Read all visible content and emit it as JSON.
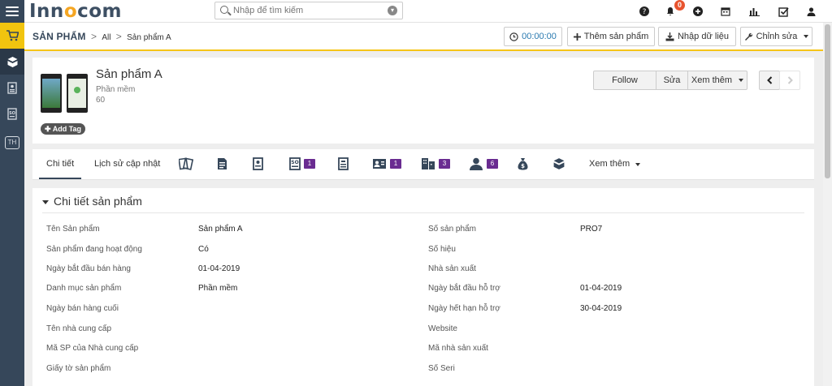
{
  "app": {
    "logo_main": "Inn",
    "logo_o": "o",
    "logo_end": "com"
  },
  "search": {
    "placeholder": "Nhập để tìm kiếm"
  },
  "notifications": {
    "count": "0"
  },
  "breadcrumb": {
    "module": "SẢN PHẨM",
    "sep1": ">",
    "all": "All",
    "sep2": ">",
    "current": "Sản phẩm A"
  },
  "toolbar": {
    "timer": "00:00:00",
    "add_product": "Thêm sản phẩm",
    "import": "Nhập dữ liệu",
    "edit": "Chỉnh sửa"
  },
  "product": {
    "name": "Sản phẩm A",
    "category": "Phần mềm",
    "number": "60",
    "add_tag": "Add Tag"
  },
  "actions": {
    "follow": "Follow",
    "edit": "Sửa",
    "more": "Xem thêm"
  },
  "tabs": {
    "detail": "Chi tiết",
    "history": "Lịch sử cập nhật",
    "more": "Xem thêm",
    "counts": {
      "quotes": "1",
      "contacts": "1",
      "orgs": "3",
      "persons": "6"
    }
  },
  "panel": {
    "title": "Chi tiết sản phẩm"
  },
  "fields_left": [
    {
      "label": "Tên Sản phẩm",
      "value": "Sản phẩm A"
    },
    {
      "label": "Sản phẩm đang hoạt động",
      "value": "Có"
    },
    {
      "label": "Ngày bắt đầu bán hàng",
      "value": "01-04-2019"
    },
    {
      "label": "Danh mục sản phẩm",
      "value": "Phần mềm"
    },
    {
      "label": "Ngày bán hàng cuối",
      "value": ""
    },
    {
      "label": "Tên nhà cung cấp",
      "value": ""
    },
    {
      "label": "Mã SP của Nhà cung cấp",
      "value": ""
    },
    {
      "label": "Giấy tờ sản phẩm",
      "value": ""
    }
  ],
  "fields_right": [
    {
      "label": "Số sản phẩm",
      "value": "PRO7"
    },
    {
      "label": "Số hiệu",
      "value": ""
    },
    {
      "label": "Nhà sản xuất",
      "value": ""
    },
    {
      "label": "Ngày bắt đầu hỗ trợ",
      "value": "01-04-2019"
    },
    {
      "label": "Ngày hết hạn hỗ trợ",
      "value": "30-04-2019"
    },
    {
      "label": "Website",
      "value": ""
    },
    {
      "label": "Mã nhà sản xuất",
      "value": ""
    },
    {
      "label": "Số Seri",
      "value": ""
    }
  ],
  "sidebar": {
    "th_label": "TH"
  },
  "colors": {
    "brand": "#36475a",
    "accent": "#f5c518",
    "badge": "#e8542f",
    "count": "#6a2c91"
  }
}
